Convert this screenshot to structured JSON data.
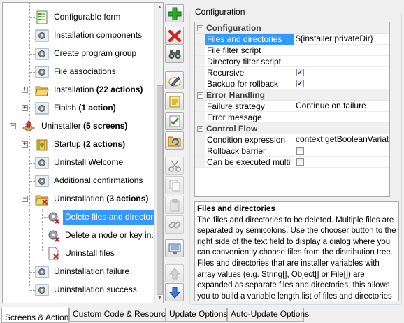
{
  "tree": {
    "items": [
      {
        "label": "Configurable form",
        "icon": "form-icon"
      },
      {
        "label": "Installation components",
        "icon": "gear-screen-icon"
      },
      {
        "label": "Create program group",
        "icon": "gear-screen-icon"
      },
      {
        "label": "File associations",
        "icon": "gear-screen-icon"
      },
      {
        "label": "Installation",
        "suffix": "(22 actions)",
        "icon": "folder-open-icon"
      },
      {
        "label": "Finish",
        "suffix": "(1 action)",
        "icon": "gear-screen-icon"
      },
      {
        "label": "Uninstaller",
        "suffix": "(5 screens)",
        "icon": "uninstaller-icon"
      },
      {
        "label": "Startup",
        "suffix": "(2 actions)",
        "icon": "startup-icon"
      },
      {
        "label": "Uninstall Welcome",
        "icon": "gear-screen-icon"
      },
      {
        "label": "Additional confirmations",
        "icon": "gear-screen-icon"
      },
      {
        "label": "Uninstallation",
        "suffix": "(3 actions)",
        "icon": "folder-delete-icon"
      },
      {
        "label": "Delete files and directories",
        "icon": "gear-delete-icon"
      },
      {
        "label": "Delete a node or key in...",
        "icon": "gear-delete-icon"
      },
      {
        "label": "Uninstall files",
        "icon": "file-delete-icon"
      },
      {
        "label": "Uninstallation failure",
        "icon": "gear-screen-icon"
      },
      {
        "label": "Uninstallation success",
        "icon": "gear-screen-icon"
      }
    ]
  },
  "toolbar": {
    "buttons": [
      "add-icon",
      "delete-icon",
      "binoculars-icon",
      "edit-icon",
      "note-icon",
      "checklist-icon",
      "folder-refresh-icon",
      "cut-icon",
      "copy-icon",
      "paste-icon",
      "link-icon",
      "screen-icon",
      "move-up-icon",
      "move-down-icon"
    ]
  },
  "config": {
    "title": "Configuration",
    "categories": [
      {
        "name": "Configuration",
        "props": [
          {
            "name": "Files and directories",
            "value": "${installer:privateDir}",
            "selected": true
          },
          {
            "name": "File filter script",
            "value": ""
          },
          {
            "name": "Directory filter script",
            "value": ""
          },
          {
            "name": "Recursive",
            "check": true
          },
          {
            "name": "Backup for rollback",
            "check": true
          }
        ]
      },
      {
        "name": "Error Handling",
        "props": [
          {
            "name": "Failure strategy",
            "value": "Continue on failure"
          },
          {
            "name": "Error message",
            "value": ""
          }
        ]
      },
      {
        "name": "Control Flow",
        "props": [
          {
            "name": "Condition expression",
            "value": "context.getBooleanVariable("
          },
          {
            "name": "Rollback barrier",
            "check": false
          },
          {
            "name": "Can be executed multi...",
            "check": false
          }
        ]
      }
    ],
    "help_title": "Files and directories",
    "help_text": "The files and directories to be deleted. Multiple files are separated by semicolons. Use the chooser button to the right side of the text field to display a dialog where you can conveniently choose files from the distribution tree. Files and directories that are installer variables with array values (e.g. String[], Object[] or File[]) are expanded as separate files and directories, this allows you to build a variable length list of files and directories at runtime."
  },
  "tabs": [
    {
      "label": "Screens & Actions",
      "active": true
    },
    {
      "label": "Custom Code & Resources"
    },
    {
      "label": "Update Options"
    },
    {
      "label": "Auto-Update Options"
    }
  ]
}
